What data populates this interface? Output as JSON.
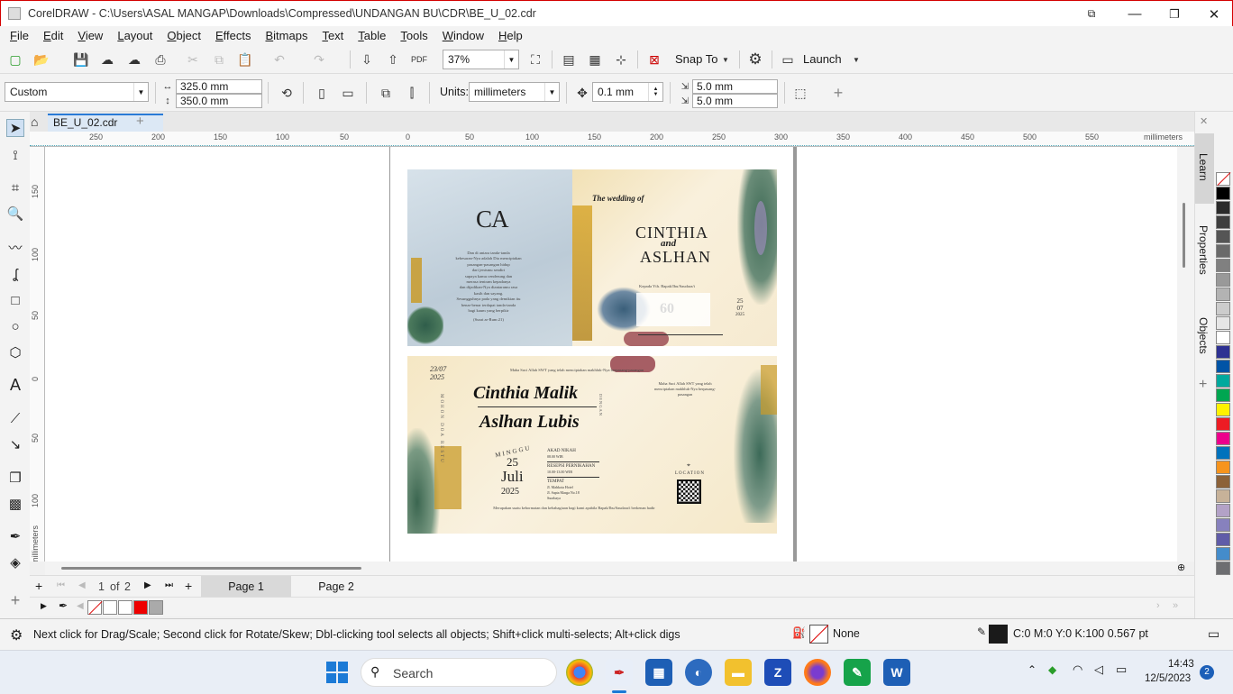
{
  "window": {
    "title": "CorelDRAW - C:\\Users\\ASAL MANGAP\\Downloads\\Compressed\\UNDANGAN BU\\CDR\\BE_U_02.cdr"
  },
  "menu": [
    "File",
    "Edit",
    "View",
    "Layout",
    "Object",
    "Effects",
    "Bitmaps",
    "Text",
    "Table",
    "Tools",
    "Window",
    "Help"
  ],
  "toolbar": {
    "zoom": "37%",
    "snap_label": "Snap To",
    "launch_label": "Launch"
  },
  "property_bar": {
    "preset": "Custom",
    "width": "325.0 mm",
    "height": "350.0 mm",
    "units_label": "Units:",
    "units_value": "millimeters",
    "nudge": "0.1 mm",
    "dup_x": "5.0 mm",
    "dup_y": "5.0 mm"
  },
  "document_tab": "BE_U_02.cdr",
  "ruler": {
    "h_labels": [
      "250",
      "200",
      "150",
      "100",
      "50",
      "0",
      "50",
      "100",
      "150",
      "200",
      "250",
      "300",
      "350",
      "400",
      "450",
      "500",
      "550"
    ],
    "h_unit": "millimeters",
    "v_labels": [
      "150",
      "100",
      "50",
      "0",
      "50",
      "100"
    ],
    "v_unit": "millimeters"
  },
  "invitation": {
    "monogram": "CA",
    "verse_lines": [
      "Dan di antara tanda-tanda",
      "kebesaran-Nya adalah Dia menciptakan",
      "pasangan-pasangan hidup",
      "dari jenismu sendiri",
      "supaya kamu cenderung dan",
      "merasa tentram kepadanya",
      "dan dijadikan-Nya diantaramu rasa",
      "kasih dan sayang.",
      "Sesungguhnya pada yang demikian itu",
      "benar-benar terdapat tanda-tanda",
      "bagi kaum yang berpikir"
    ],
    "verse_source": "(Surat ar-Rum:21)",
    "wedding_of": "The wedding of",
    "groom_top": "CINTHIA",
    "and": "and",
    "bride_top": "ASLHAN",
    "to_label": "Kepada Yth. Bapak/Ibu/Saudara/i",
    "date_day": "25",
    "date_month": "07",
    "date_year": "2025",
    "stamp": "60",
    "left_date": "23/07",
    "left_year": "2025",
    "mohon_doa": "MOHON DOA RESTU",
    "bride_script": "Cinthia Malik",
    "groom_script": "Aslhan Lubis",
    "dengan": "DENGAN",
    "minggu": "MINGGU",
    "day": "25",
    "month": "Juli",
    "year": "2025",
    "akad": "AKAD NIKAH",
    "akad_time": "08.00 WIB",
    "resepsi": "RESEPSI PERNIKAHAN",
    "resepsi_time": "10.00-13.00 WIB",
    "tempat": "TEMPAT",
    "address": "Jl. Mahkota Hotel",
    "address2": "Jl. Sapta Marga No.18",
    "city": "Surabaya",
    "intro": "Maha Suci Allah SWT yang telah menciptakan makhluk-Nya berpasang-pasangan",
    "location": "LOCATION",
    "closing": "Merupakan suatu kehormatan dan kebahagiaan bagi kami apabila Bapak/Ibu/Saudara/i berkenan hadir"
  },
  "pages": {
    "current": "1",
    "of": "of",
    "total": "2",
    "tab1": "Page 1",
    "tab2": "Page 2"
  },
  "dock": {
    "learn": "Learn",
    "properties": "Properties",
    "objects": "Objects"
  },
  "status": {
    "hint": "Next click for Drag/Scale; Second click for Rotate/Skew; Dbl-clicking tool selects all objects; Shift+click multi-selects; Alt+click digs",
    "fill": "None",
    "outline": "C:0 M:0 Y:0 K:100  0.567 pt"
  },
  "taskbar": {
    "search": "Search",
    "time": "14:43",
    "date": "12/5/2023",
    "badge": "2"
  },
  "colors": {
    "accent": "#2a7bd6",
    "card_bg": "#f6ecd2",
    "blue_panel": "#c9d6e0"
  }
}
